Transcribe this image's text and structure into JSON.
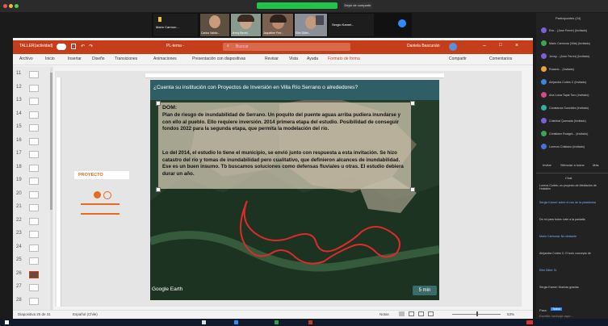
{
  "zoom": {
    "sharing_banner": "Usted está compartiendo la pantalla",
    "stop_share_label": "Dejar de compartir",
    "hide_label": "Ocultar"
  },
  "participants_strip": [
    {
      "name": "Mario Carmon..."
    },
    {
      "name": "Carlos Valdiv..."
    },
    {
      "name": "Jenny Bennt..."
    },
    {
      "name": "Jaqueline Ferr..."
    },
    {
      "name": "Eliel Gillet..."
    },
    {
      "name": "Sergio Kamel..."
    }
  ],
  "ppt": {
    "file_name": "TALLER(actividad)",
    "autosave": "",
    "doc_title": "PL-tema - ",
    "search_placeholder": "Buscar",
    "user": "Daniela Bascunán",
    "tabs": [
      "Archivo",
      "Inicio",
      "Insertar",
      "Diseño",
      "Transiciones",
      "Animaciones",
      "Presentación con diapositivas",
      "Revisar",
      "Vista",
      "Ayuda",
      "Formato de forma"
    ],
    "share": "Compartir",
    "comments": "Comentarios",
    "thumb_numbers": [
      "11",
      "12",
      "13",
      "14",
      "15",
      "16",
      "17",
      "18",
      "19",
      "20",
      "21",
      "22",
      "23",
      "24",
      "25",
      "26",
      "27",
      "28"
    ],
    "status_left": "Diapositiva 25 de 31",
    "status_lang": "Español (Chile)",
    "status_notes": "Notas",
    "zoom_pct": "53%"
  },
  "slide": {
    "title": "¿Cuenta su institución con Proyectos de Inversión en Villa Río Serrano o alrededores?",
    "dom": "DOM:",
    "paragraph1": "Plan de riesgo de inundabilidad de Serrano. Un poquito del puente aguas arriba pudiera inundarse y con ello al pueblo. Ello requiere inversión. 2014 primera etapa del estudio. Posibilidad de conseguir fondos 2022 para la segunda etapa, que permita la modelación del río.",
    "paragraph2": "Lo del 2014, el estudio lo tiene el municipio, se envió junto con respuesta a esta invitación. Se hizo catastro del río y tomas de inundabilidad pero cualitativo, que definieron alcances de inundabilidad. Ese es un buen insumo. Tb buscamos soluciones como defensas fluviales u otras. El estudio debiera durar un año.",
    "brand": "Google Earth",
    "timer": "5 min",
    "side_label": "PROYECTO"
  },
  "panel": {
    "participants_title": "Participantes (24)",
    "participants": [
      "Eric... (Jose Ferrer) (Invitado)",
      "Mario Carmona (Villa) (Invitado)",
      "Jenny... (Jose Ferrer) (Invitado)",
      "Rosario... (Invitado)",
      "Alejandra Cortes C (Invitado)",
      "Ana Luisa Tapia Toro (Invitado)",
      "Constanza González (Invitado)",
      "Cristóbal Quezada (Invitado)",
      "Christiane Rosignt... (Invitado)",
      "Lorenzo Cristiano (Invitado)"
    ],
    "invite": "Invitar",
    "mute_all": "Silenciar a todos",
    "more": "Más",
    "chat_title": "Chat",
    "chat_messages": [
      "Lorena Cortés: un proyecto de Mediación de Hostales",
      "Sergio Kamel: sobre el uso de la plataforma",
      "De mí para todos: sale a la pantalla",
      "Mario Carmona: No obstante",
      "Alejandra Cortes C: El solo concepto de",
      "Eliel Gillet: Sí",
      "Sergio Kamel: Muchas gracias"
    ],
    "to_label": "Para:",
    "to_value": "Todos",
    "type_placeholder": "Escribir mensaje aquí..."
  },
  "colors": {
    "ppt_red": "#c43e1c",
    "slide_head": "#2f5e66",
    "accent_orange": "#e66b1f",
    "zoom_green": "#24c44a"
  }
}
